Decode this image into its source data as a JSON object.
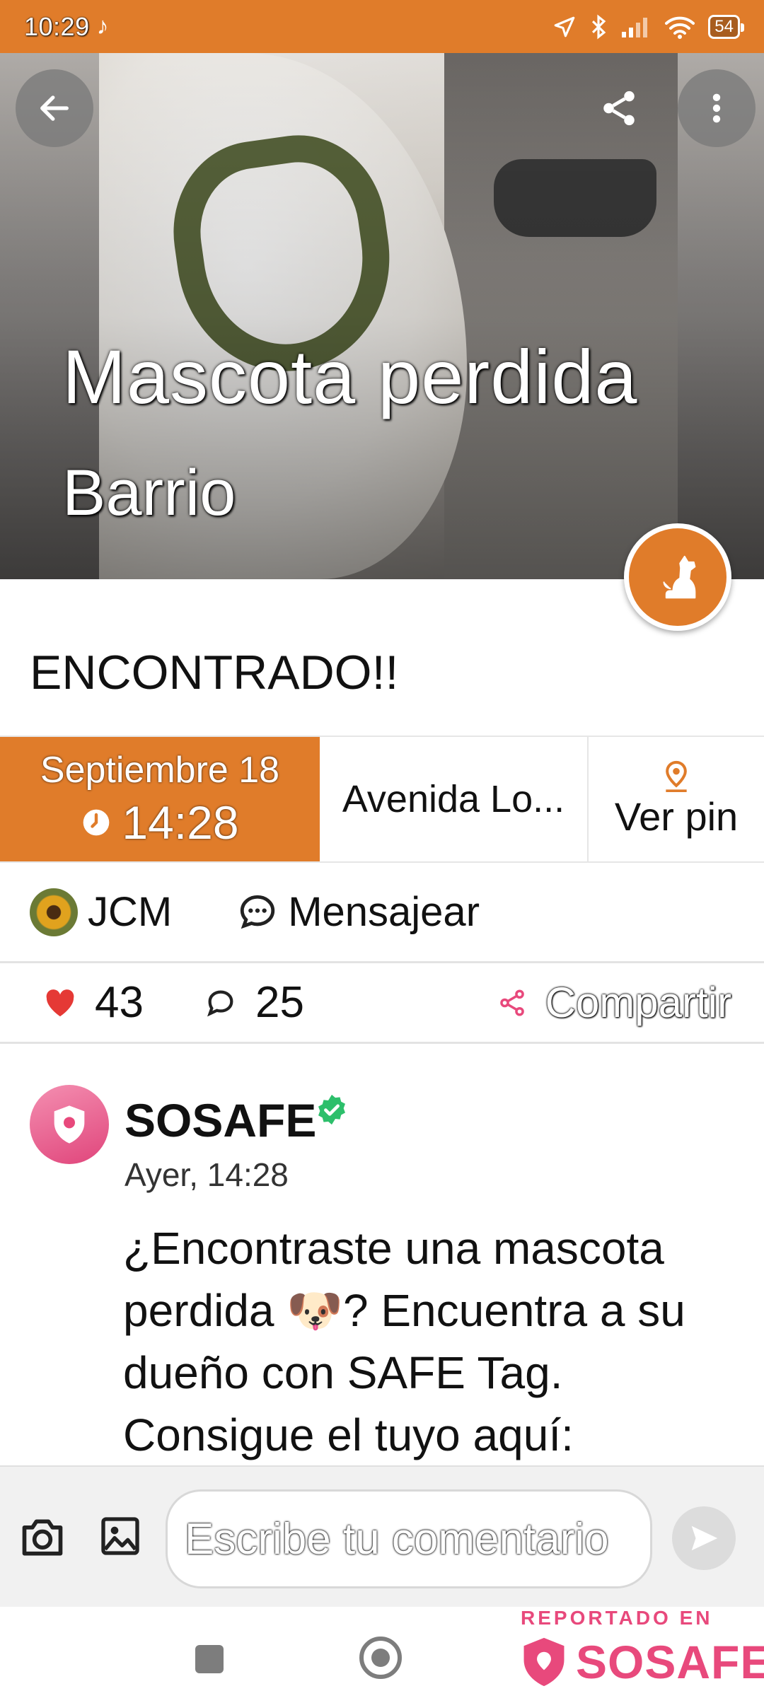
{
  "status_bar": {
    "time": "10:29",
    "battery": "54"
  },
  "hero": {
    "title": "Mascota perdida",
    "subtitle": "Barrio"
  },
  "post": {
    "status": "ENCONTRADO!!",
    "date": "Septiembre 18",
    "time": "14:28",
    "address": "Avenida Lo...",
    "pin_label": "Ver pin",
    "author": "JCM",
    "message_label": "Mensajear",
    "likes": "43",
    "comments": "25",
    "share_label": "Compartir"
  },
  "comment": {
    "author": "SOSAFE",
    "time": "Ayer, 14:28",
    "text": "¿Encontraste una mascota perdida 🐶? Encuentra a su dueño con SAFE Tag. Consigue el tuyo aquí:"
  },
  "composer": {
    "placeholder": "Escribe tu comentario"
  },
  "watermark": {
    "reported": "REPORTADO EN",
    "brand": "SOSAFE"
  },
  "colors": {
    "accent": "#e07c2a",
    "brand_pink": "#e8497c",
    "like_red": "#e53935",
    "verified_green": "#2dbf6b"
  }
}
